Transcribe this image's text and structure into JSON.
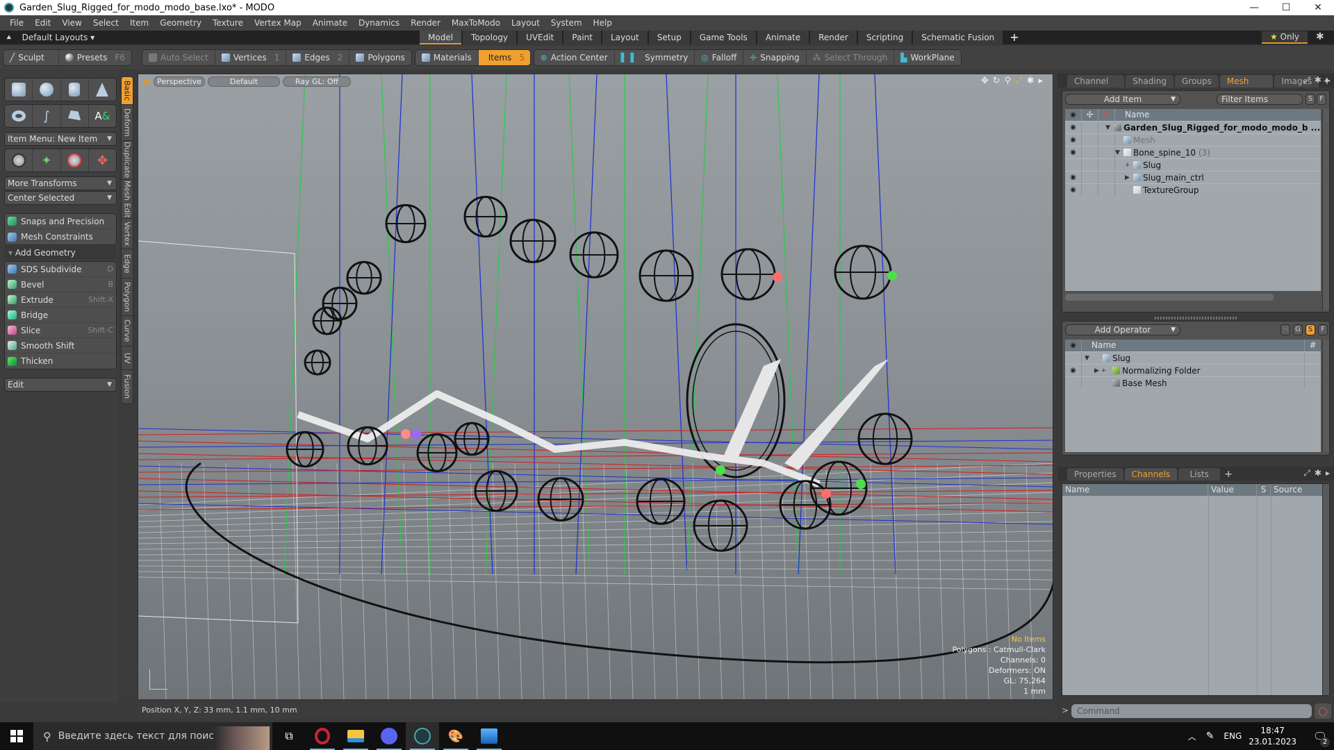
{
  "window": {
    "title": "Garden_Slug_Rigged_for_modo_modo_base.lxo* - MODO",
    "controls": [
      "minimize",
      "maximize",
      "close"
    ]
  },
  "menu": [
    "File",
    "Edit",
    "View",
    "Select",
    "Item",
    "Geometry",
    "Texture",
    "Vertex Map",
    "Animate",
    "Dynamics",
    "Render",
    "MaxToModo",
    "Layout",
    "System",
    "Help"
  ],
  "layout_bar": {
    "default_layouts": "Default Layouts",
    "tabs": [
      "Model",
      "Topology",
      "UVEdit",
      "Paint",
      "Layout",
      "Setup",
      "Game Tools",
      "Animate",
      "Render",
      "Scripting",
      "Schematic Fusion"
    ],
    "active_tab": "Model",
    "add_tab": "+",
    "only_label": "Only"
  },
  "toolbar": {
    "sculpt": "Sculpt",
    "presets": "Presets",
    "presets_key": "F6",
    "auto_select": "Auto Select",
    "vertices": "Vertices",
    "vertices_key": "1",
    "edges": "Edges",
    "edges_key": "2",
    "polygons": "Polygons",
    "materials": "Materials",
    "items": "Items",
    "items_key": "5",
    "action_center": "Action Center",
    "symmetry": "Symmetry",
    "falloff": "Falloff",
    "snapping": "Snapping",
    "select_through": "Select Through",
    "workplane": "WorkPlane"
  },
  "left_panel": {
    "primitives_row1": [
      "cube-icon",
      "sphere-icon",
      "cylinder-icon",
      "cone-icon"
    ],
    "primitives_row2": [
      "torus-icon",
      "spring-icon",
      "pen-polygon-icon",
      "text-icon"
    ],
    "item_menu": "Item Menu: New Item",
    "transforms": [
      "move-icon",
      "rotate-icon",
      "scale-icon",
      "transform-icon"
    ],
    "more_transforms": "More Transforms",
    "center_selected": "Center Selected",
    "snaps": "Snaps and Precision",
    "mesh_constraints": "Mesh Constraints",
    "add_geometry": "Add Geometry",
    "geometry_tools": [
      {
        "label": "SDS Subdivide",
        "key": "D"
      },
      {
        "label": "Bevel",
        "key": "B"
      },
      {
        "label": "Extrude",
        "key": "Shift-X"
      },
      {
        "label": "Bridge",
        "key": ""
      },
      {
        "label": "Slice",
        "key": "Shift-C"
      },
      {
        "label": "Smooth Shift",
        "key": ""
      },
      {
        "label": "Thicken",
        "key": ""
      }
    ],
    "edit_dropdown": "Edit",
    "vertical_tabs": [
      "Basic",
      "Deform",
      "Duplicate",
      "Mesh Edit",
      "Vertex",
      "Edge",
      "Polygon",
      "Curve",
      "UV",
      "Fusion"
    ],
    "active_vertical_tab": "Basic"
  },
  "viewport": {
    "view": "Perspective",
    "shading": "Default",
    "raygl": "Ray GL: Off",
    "info": {
      "selection": "No Items",
      "polygons": "Polygons : Catmull-Clark",
      "channels": "Channels: 0",
      "deformers": "Deformers: ON",
      "gl": "GL: 75,264",
      "unit": "1 mm"
    }
  },
  "status_bar": {
    "position": "Position X, Y, Z:   33 mm, 1.1 mm, 10 mm"
  },
  "items_panel": {
    "tabs": [
      "Channel ...",
      "Shading",
      "Groups",
      "Mesh Ops",
      "Images"
    ],
    "active_tab": "Mesh Ops",
    "add_item": "Add Item",
    "filter_placeholder": "Filter Items",
    "s_btn": "S",
    "f_btn": "F",
    "col_name": "Name",
    "rows": [
      {
        "name": "Garden_Slug_Rigged_for_modo_modo_b ...",
        "eye": true,
        "icon": "scene-icon",
        "bold": true,
        "dim": false,
        "expander": "▼",
        "count": ""
      },
      {
        "name": "Mesh",
        "eye": true,
        "icon": "mesh-icon",
        "bold": false,
        "dim": true,
        "expander": "",
        "count": ""
      },
      {
        "name": "Bone_spine_10",
        "eye": true,
        "icon": "folder-icon",
        "bold": false,
        "dim": false,
        "expander": "▼",
        "count": "(3)"
      },
      {
        "name": "Slug",
        "eye": false,
        "icon": "mesh-icon",
        "bold": false,
        "dim": false,
        "expander": "+",
        "count": ""
      },
      {
        "name": "Slug_main_ctrl",
        "eye": true,
        "icon": "mesh-icon",
        "bold": false,
        "dim": false,
        "expander": "▶",
        "count": ""
      },
      {
        "name": "TextureGroup",
        "eye": true,
        "icon": "folder-icon",
        "bold": false,
        "dim": false,
        "expander": "",
        "count": ""
      }
    ]
  },
  "meshops_panel": {
    "add_operator": "Add Operator",
    "buttons": [
      "H",
      "G",
      "S",
      "F"
    ],
    "active_button": "S",
    "col_name": "Name",
    "col_hash": "#",
    "rows": [
      {
        "name": "Slug",
        "eye": false,
        "icon": "mesh-icon",
        "expander": "▼"
      },
      {
        "name": "Normalizing Folder",
        "eye": true,
        "icon": "green-folder-icon",
        "expander": "▶ +"
      },
      {
        "name": "Base Mesh",
        "eye": false,
        "icon": "gray-mesh-icon",
        "expander": ""
      }
    ]
  },
  "channels_panel": {
    "tabs": [
      "Properties",
      "Channels",
      "Lists"
    ],
    "active_tab": "Channels",
    "columns": [
      "Name",
      "Value",
      "S",
      "Source"
    ]
  },
  "command": {
    "prompt": ">",
    "placeholder": "Command"
  },
  "taskbar": {
    "search_placeholder": "Введите здесь текст для поиска",
    "apps": [
      "task-view-icon",
      "opera-icon",
      "file-explorer-icon",
      "discord-icon",
      "modo-icon",
      "paint-icon",
      "photos-icon"
    ],
    "active_app": "modo-icon",
    "language": "ENG",
    "time": "18:47",
    "date": "23.01.2023",
    "notifications": "2"
  },
  "colors": {
    "accent": "#f0a030",
    "viewport_top": "#9aa0a4",
    "viewport_bottom": "#6e7478",
    "info_highlight": "#f3c95a"
  }
}
